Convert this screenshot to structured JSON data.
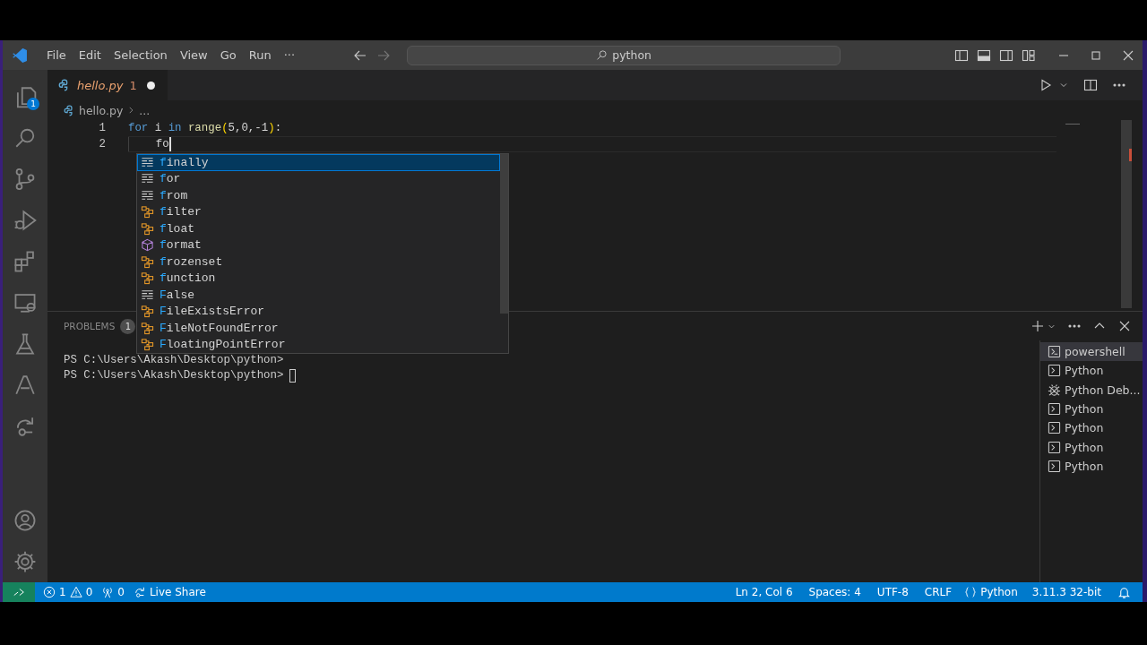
{
  "menu": [
    "File",
    "Edit",
    "Selection",
    "View",
    "Go",
    "Run",
    "···"
  ],
  "search": {
    "value": "python"
  },
  "activity_items": [
    {
      "kind": "explorer",
      "badge": "1"
    },
    {
      "kind": "search"
    },
    {
      "kind": "scm"
    },
    {
      "kind": "debug"
    },
    {
      "kind": "extensions"
    },
    {
      "kind": "remote"
    },
    {
      "kind": "testing"
    },
    {
      "kind": "azure"
    },
    {
      "kind": "liveshare"
    }
  ],
  "activity_bottom": [
    {
      "kind": "account"
    },
    {
      "kind": "settings"
    }
  ],
  "editor_tabs": [
    {
      "label": "hello.py",
      "problems": "1",
      "dirty": true,
      "selected": true
    }
  ],
  "breadcrumbs": [
    "hello.py",
    "..."
  ],
  "code_lines": [
    {
      "number": "1",
      "cursor": false,
      "indent_guide": false,
      "tokens": [
        {
          "text": "for",
          "kind": "keyword"
        },
        {
          "text": " i ",
          "kind": "plain"
        },
        {
          "text": "in",
          "kind": "keyword"
        },
        {
          "text": " range",
          "kind": "function"
        },
        {
          "text": "(",
          "kind": "bracket"
        },
        {
          "text": "5,0,-1",
          "kind": "plain"
        },
        {
          "text": ")",
          "kind": "bracket"
        },
        {
          "text": ":",
          "kind": "plain"
        }
      ]
    },
    {
      "number": "2",
      "cursor": true,
      "indent_guide": true,
      "tokens": [
        {
          "text": "    fo",
          "kind": "plain"
        }
      ]
    }
  ],
  "suggestions": [
    {
      "label": "finally",
      "kind": "keyword",
      "selected": true
    },
    {
      "label": "for",
      "kind": "keyword",
      "selected": false
    },
    {
      "label": "from",
      "kind": "keyword",
      "selected": false
    },
    {
      "label": "filter",
      "kind": "class",
      "selected": false
    },
    {
      "label": "float",
      "kind": "class",
      "selected": false
    },
    {
      "label": "format",
      "kind": "method",
      "selected": false
    },
    {
      "label": "frozenset",
      "kind": "class",
      "selected": false
    },
    {
      "label": "function",
      "kind": "class",
      "selected": false
    },
    {
      "label": "False",
      "kind": "keyword",
      "selected": false
    },
    {
      "label": "FileExistsError",
      "kind": "class",
      "selected": false
    },
    {
      "label": "FileNotFoundError",
      "kind": "class",
      "selected": false
    },
    {
      "label": "FloatingPointError",
      "kind": "class",
      "selected": false
    }
  ],
  "panel": {
    "tabs": [
      {
        "label": "PROBLEMS",
        "count": "1",
        "selected": false
      }
    ],
    "terminal_lines": [
      {
        "text": "PS C:\\Users\\Akash\\Desktop\\python>",
        "cursor": false
      },
      {
        "text": "PS C:\\Users\\Akash\\Desktop\\python>",
        "cursor": true
      }
    ],
    "terminals": [
      {
        "label": "powershell",
        "kind": "shell",
        "selected": true
      },
      {
        "label": "Python",
        "kind": "shell",
        "selected": false
      },
      {
        "label": "Python Deb...",
        "kind": "debug",
        "selected": false
      },
      {
        "label": "Python",
        "kind": "shell",
        "selected": false
      },
      {
        "label": "Python",
        "kind": "shell",
        "selected": false
      },
      {
        "label": "Python",
        "kind": "shell",
        "selected": false
      },
      {
        "label": "Python",
        "kind": "shell",
        "selected": false
      }
    ]
  },
  "status_bar": {
    "errors": "1",
    "warnings": "0",
    "ports": "0",
    "live_share": "Live Share",
    "position": "Ln 2, Col 6",
    "indent": "Spaces: 4",
    "encoding": "UTF-8",
    "eol": "CRLF",
    "language": "Python",
    "interpreter": "3.11.3 32-bit"
  }
}
